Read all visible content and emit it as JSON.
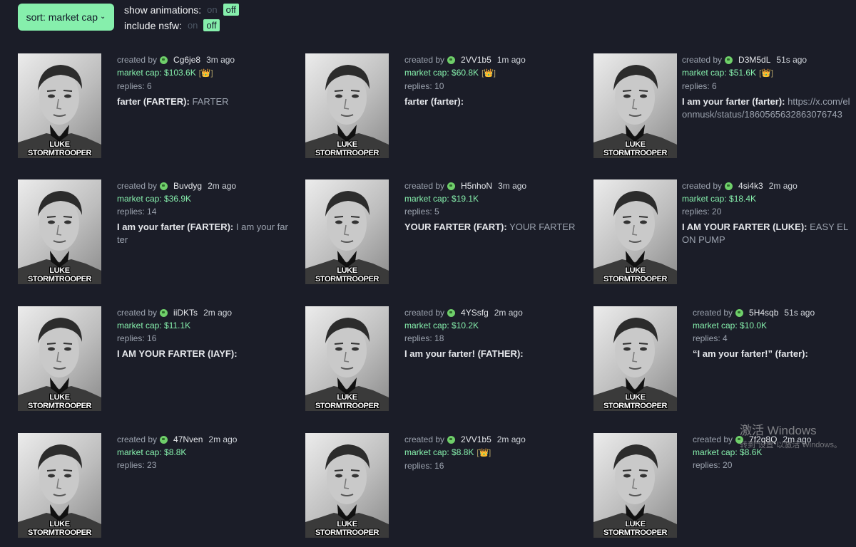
{
  "toolbar": {
    "sort_label": "sort: market cap",
    "show_animations_label": "show animations:",
    "include_nsfw_label": "include nsfw:",
    "on_label": "on",
    "off_label": "off"
  },
  "image_caption": "LUKE STORMTROOPER",
  "cards": [
    {
      "created_by": "created by",
      "user": "Cg6je8",
      "time": "3m ago",
      "market_cap": "market cap: $103.6K",
      "crown": true,
      "replies": "replies: 6",
      "title_name": "farter (FARTER):",
      "title_desc": "FARTER"
    },
    {
      "created_by": "created by",
      "user": "2VV1b5",
      "time": "1m ago",
      "market_cap": "market cap: $60.8K",
      "crown": true,
      "replies": "replies: 10",
      "title_name": "farter (farter):",
      "title_desc": ""
    },
    {
      "created_by": "created by",
      "user": "D3M5dL",
      "time": "51s ago",
      "market_cap": "market cap: $51.6K",
      "crown": true,
      "replies": "replies: 6",
      "title_name": "I am your farter (farter):",
      "title_desc": "https://x.com/elonmusk/status/1860565632863076743"
    },
    {
      "created_by": "created by",
      "user": "Buvdyg",
      "time": "2m ago",
      "market_cap": "market cap: $36.9K",
      "crown": false,
      "replies": "replies: 14",
      "title_name": "I am your farter (FARTER):",
      "title_desc": "I am your farter"
    },
    {
      "created_by": "created by",
      "user": "H5nhoN",
      "time": "3m ago",
      "market_cap": "market cap: $19.1K",
      "crown": false,
      "replies": "replies: 5",
      "title_name": "YOUR FARTER (FART):",
      "title_desc": "YOUR FARTER"
    },
    {
      "created_by": "created by",
      "user": "4si4k3",
      "time": "2m ago",
      "market_cap": "market cap: $18.4K",
      "crown": false,
      "replies": "replies: 20",
      "title_name": "I AM YOUR FARTER (LUKE):",
      "title_desc": "EASY ELON PUMP"
    },
    {
      "created_by": "created by",
      "user": "iiDKTs",
      "time": "2m ago",
      "market_cap": "market cap: $11.1K",
      "crown": false,
      "replies": "replies: 16",
      "title_name": "I AM YOUR FARTER (IAYF):",
      "title_desc": ""
    },
    {
      "created_by": "created by",
      "user": "4YSsfg",
      "time": "2m ago",
      "market_cap": "market cap: $10.2K",
      "crown": false,
      "replies": "replies: 18",
      "title_name": "I am your farter! (FATHER):",
      "title_desc": ""
    },
    {
      "created_by": "created by",
      "user": "5H4sqb",
      "time": "51s ago",
      "market_cap": "market cap: $10.0K",
      "crown": false,
      "replies": "replies: 4",
      "title_name": "“I am your farter!” (farter):",
      "title_desc": ""
    },
    {
      "created_by": "created by",
      "user": "47Nven",
      "time": "2m ago",
      "market_cap": "market cap: $8.8K",
      "crown": false,
      "replies": "replies: 23",
      "title_name": "",
      "title_desc": ""
    },
    {
      "created_by": "created by",
      "user": "2VV1b5",
      "time": "2m ago",
      "market_cap": "market cap: $8.8K",
      "crown": true,
      "replies": "replies: 16",
      "title_name": "",
      "title_desc": ""
    },
    {
      "created_by": "created by",
      "user": "7f2q8Q",
      "time": "2m ago",
      "market_cap": "market cap: $8.6K",
      "crown": false,
      "replies": "replies: 20",
      "title_name": "",
      "title_desc": ""
    }
  ],
  "watermark": {
    "title": "激活 Windows",
    "subtitle": "转到“设置”以激活 Windows。"
  }
}
